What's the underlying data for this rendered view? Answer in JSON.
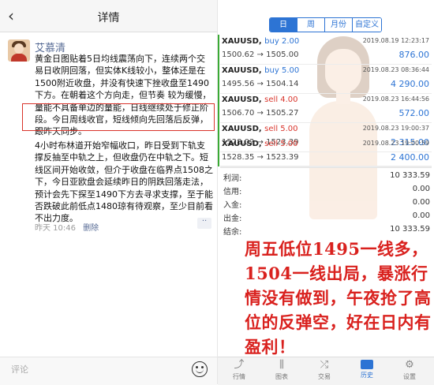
{
  "left": {
    "header_title": "详情",
    "back_glyph": "‹",
    "author": "艾慕清",
    "paragraph1": "黄金日图贴着5日均线震荡向下，连续两个交易日收阴回落，但实体K线较小，整体还是在1500附近收盘，并没有快速下挫收盘至1490下方。在朝着这个方向走，但节奏 较为缓慢，量能不具备单边的量能，日线继续处于修正阶段。今日周线收官，短线倾向先回落后反弹，跟昨天同步。",
    "paragraph2": "4小时布林道开始窄幅收口，昨日受到下轨支撑反抽至中轨之上，但收盘仍在中轨之下。短线区间开始收敛，但介于收盘在临界点1508之下，今日亚欧盘会延续昨日的阴跌回落走法，预计会先下探至1490下方去寻求支撑，至于能否跌破此前低点1480琼有待观察，至少目前看不出力度。",
    "time": "昨天 10:46",
    "delete": "删除",
    "more": "··",
    "comment_placeholder": "评论",
    "emoji_icon": "emoji-icon"
  },
  "right": {
    "tabs": [
      {
        "label": "日",
        "active": true
      },
      {
        "label": "周",
        "active": false
      },
      {
        "label": "月份",
        "active": false
      },
      {
        "label": "自定义",
        "active": false
      }
    ],
    "trades": [
      {
        "symbol": "XAUUSD,",
        "side": "buy 2.00",
        "side_type": "buy",
        "date": "2019.08.19 12:23:17",
        "price": "1500.62 → 1505.00",
        "profit": "876.00"
      },
      {
        "symbol": "XAUUSD,",
        "side": "buy 5.00",
        "side_type": "buy",
        "date": "2019.08.23 08:36:44",
        "price": "1495.56 → 1504.14",
        "profit": "4 290.00"
      },
      {
        "symbol": "XAUUSD,",
        "side": "sell 4.00",
        "side_type": "sell",
        "date": "2019.08.23 16:44:56",
        "price": "1506.70 → 1505.27",
        "profit": "572.00"
      },
      {
        "symbol": "XAUUSD,",
        "side": "sell 5.00",
        "side_type": "sell",
        "date": "2019.08.23 19:00:37",
        "price": "1528.02 → 1523.39",
        "profit": "2 315.00"
      },
      {
        "symbol": "XAUUSD,",
        "side": "sell 5.00",
        "side_type": "sell",
        "date": "2019.08.23 19:00:59",
        "price": "1528.35 → 1523.39",
        "profit": "2 400.00"
      }
    ],
    "summary": [
      {
        "label": "利润:",
        "value": "10 333.59"
      },
      {
        "label": "信用:",
        "value": "0.00"
      },
      {
        "label": "入金:",
        "value": "0.00"
      },
      {
        "label": "出金:",
        "value": "0.00"
      },
      {
        "label": "结余:",
        "value": "10 333.59"
      }
    ],
    "caption": "周五低位1495一线多，1504一线出局，暴涨行情没有做到，午夜抢了高位的反弹空，好在日内有盈利！",
    "nav": [
      {
        "label": "行情",
        "icon": "chart-trend-icon",
        "glyph": "⤴"
      },
      {
        "label": "图表",
        "icon": "candlestick-icon",
        "glyph": "⫼"
      },
      {
        "label": "交易",
        "icon": "trade-icon",
        "glyph": "⤮"
      },
      {
        "label": "历史",
        "icon": "history-icon",
        "glyph": "",
        "active": true
      },
      {
        "label": "设置",
        "icon": "gear-icon",
        "glyph": "⚙"
      }
    ],
    "colors": {
      "accent": "#2d74d4",
      "sell": "#d9342b",
      "caption": "#d9211e"
    }
  }
}
